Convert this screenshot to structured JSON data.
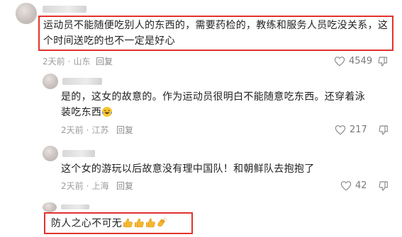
{
  "comments": [
    {
      "username": "",
      "text": "运动员不能随便吃别人的东西的，需要药检的，教练和服务人员吃没关系，这个时间送吃的也不一定是好心",
      "time": "2天前",
      "location": "山东",
      "reply_label": "回复",
      "likes": "4549"
    },
    {
      "username": "",
      "text": "是的，这女的故意的。作为运动员很明白不能随意吃东西。还穿着泳装吃东西",
      "time": "2天前",
      "location": "江苏",
      "reply_label": "回复",
      "likes": "217"
    },
    {
      "username": "",
      "text": "这个女的游玩以后故意没有理中国队！和朝鲜队去抱抱了",
      "time": "2天前",
      "location": "上海",
      "reply_label": "回复",
      "likes": "42"
    },
    {
      "username": "",
      "text": "防人之心不可无",
      "time": "",
      "location": "",
      "reply_label": "",
      "likes": ""
    }
  ],
  "colors": {
    "highlight_box": "#e3322e",
    "meta_text": "#9c9c9c",
    "body_text": "#222222"
  },
  "icons": [
    "heart-outline-icon",
    "thumbs-down-outline-icon",
    "laughing-tears-emoji",
    "thumbs-up-emoji",
    "clapping-hands-emoji"
  ]
}
